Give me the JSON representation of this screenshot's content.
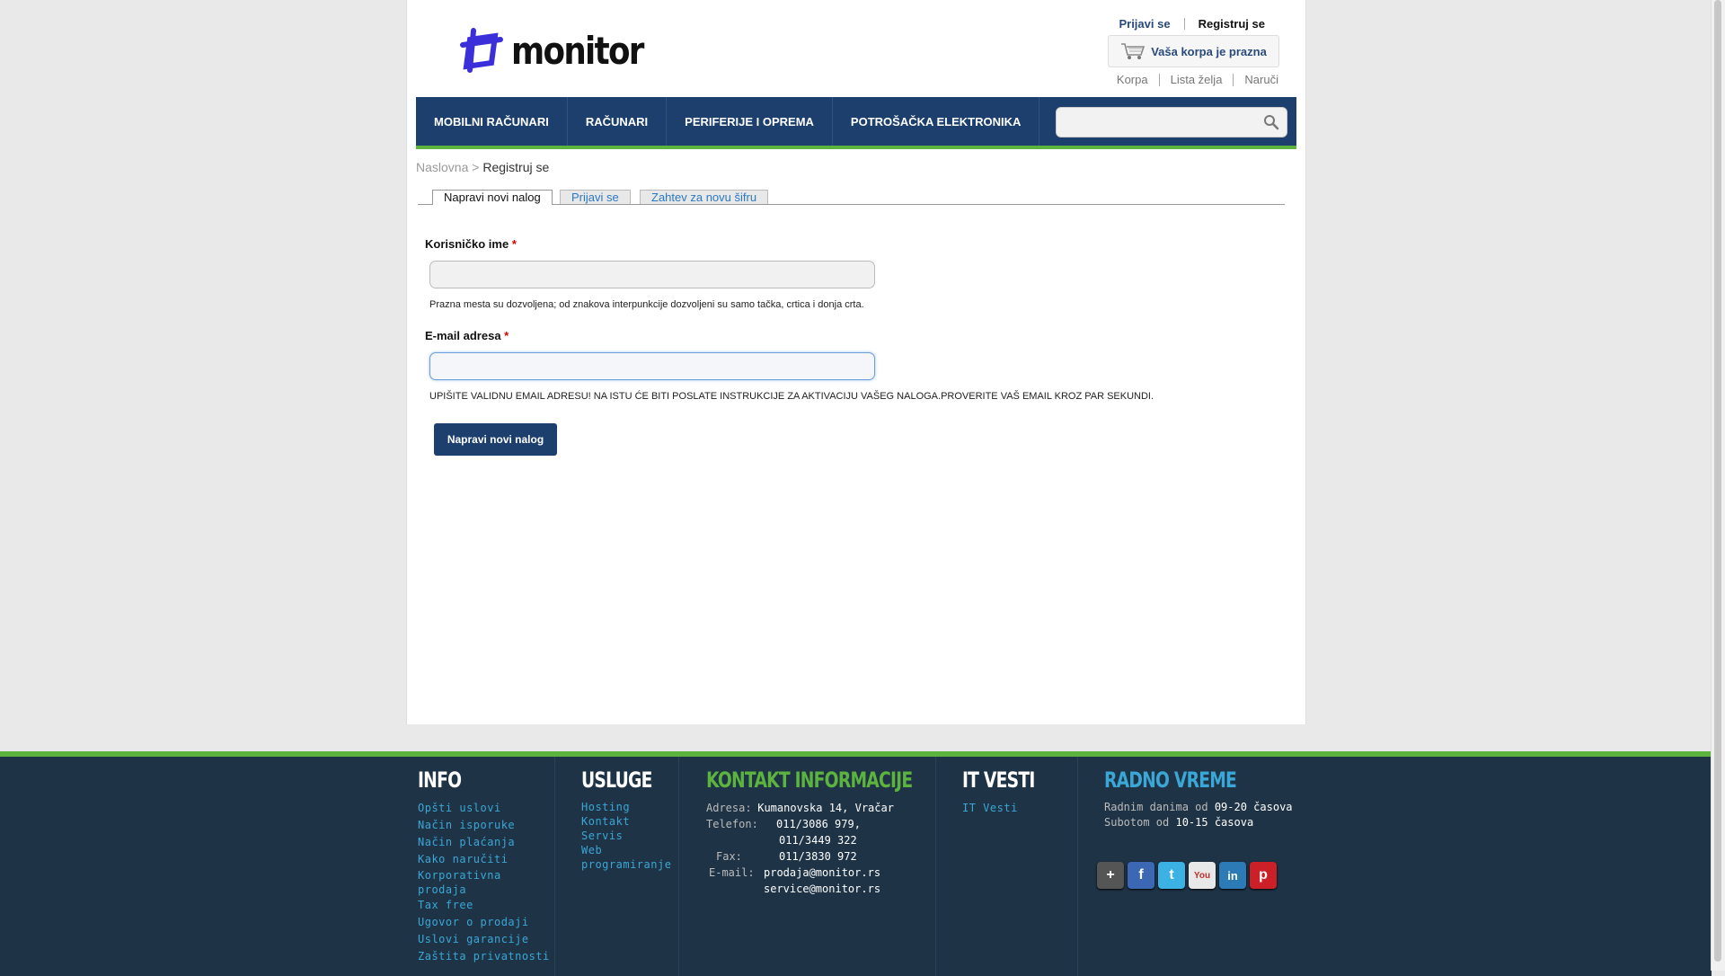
{
  "header": {
    "logo_text": "monitor",
    "login_link": "Prijavi se",
    "register_link": "Registruj se",
    "cart_label": "Vaša korpa je prazna",
    "sub_links": [
      "Korpa",
      "Lista želja",
      "Naruči"
    ]
  },
  "nav": {
    "items": [
      "MOBILNI RAČUNARI",
      "RAČUNARI",
      "PERIFERIJE I OPREMA",
      "POTROŠAČKA ELEKTRONIKA"
    ],
    "search_placeholder": ""
  },
  "breadcrumb": {
    "home": "Naslovna",
    "separator": ">",
    "current": "Registruj se"
  },
  "tabs": [
    "Napravi novi nalog",
    "Prijavi se",
    "Zahtev za novu šifru"
  ],
  "form": {
    "username_label": "Korisničko ime",
    "username_value": "",
    "username_hint": "Prazna mesta su dozvoljena; od znakova interpunkcije dozvoljeni su samo tačka, crtica i donja crta.",
    "email_label": "E-mail adresa",
    "email_value": "",
    "email_hint": "UPIŠITE VALIDNU EMAIL ADRESU! NA ISTU ĆE BITI POSLATE INSTRUKCIJE ZA AKTIVACIJU VAŠEG NALOGA.PROVERITE VAŠ EMAIL KROZ PAR SEKUNDI.",
    "required_mark": "*",
    "submit_label": "Napravi novi nalog"
  },
  "footer": {
    "info": {
      "heading": "INFO",
      "links": [
        "Opšti uslovi",
        "Način isporuke",
        "Način plaćanja",
        "Kako naručiti",
        "Korporativna",
        "prodaja",
        "Tax free",
        "Ugovor o prodaji",
        "Uslovi garancije",
        "Zaštita privatnosti"
      ]
    },
    "usluge": {
      "heading": "USLUGE",
      "links": [
        "Hosting",
        "Kontakt",
        "Servis",
        "Web",
        "programiranje"
      ]
    },
    "kontakt": {
      "heading": "KONTAKT INFORMACIJE",
      "address_label": "Adresa:",
      "address": "Kumanovska 14, Vračar",
      "phone_label": "Telefon:",
      "phone1": "011/3086 979,",
      "phone2": "011/3449 322",
      "fax_label": "Fax:",
      "fax": "011/3830 972",
      "email_label": "E-mail:",
      "email1": "prodaja@monitor.rs",
      "email2": "service@monitor.rs"
    },
    "it_vesti": {
      "heading": "IT VESTI",
      "links": [
        "IT Vesti"
      ]
    },
    "radno_vreme": {
      "heading": "RADNO VREME",
      "weekday_prefix": "Radnim danima od",
      "weekday_hours": "09-20 časova",
      "saturday_prefix": "Subotom od",
      "saturday_hours": "10-15 časova"
    },
    "social_icons": [
      "google-plus-icon",
      "facebook-icon",
      "twitter-icon",
      "youtube-icon",
      "linkedin-icon",
      "pinterest-icon"
    ]
  },
  "colors": {
    "nav_bg": "#1d3f6e",
    "accent_green": "#5cb33e",
    "footer_bg": "#1f3346",
    "link_blue": "#3aa7d6",
    "required_red": "#dd0000"
  }
}
